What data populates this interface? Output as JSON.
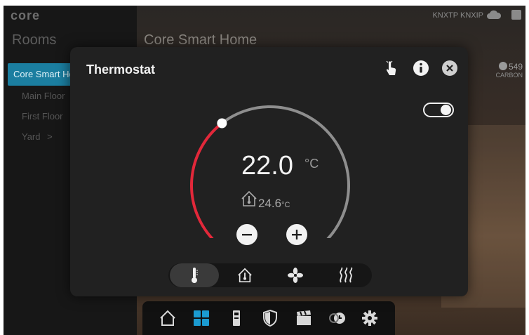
{
  "app": {
    "logo": "core"
  },
  "sidebar": {
    "title": "Rooms",
    "active_room": "Core Smart Home",
    "rooms": [
      {
        "label": "Main Floor"
      },
      {
        "label": "First Floor"
      },
      {
        "label": "Yard"
      }
    ]
  },
  "main": {
    "title": "Core Smart Home",
    "status_text": "KNXTP  KNXIP",
    "carbon_value": "549",
    "carbon_label": "CARBON"
  },
  "thermostat": {
    "title": "Thermostat",
    "power_on": true,
    "setpoint": "22.0",
    "setpoint_unit": "°C",
    "room_temperature": "24.6",
    "room_temperature_unit": "°C",
    "dial_fraction": 0.36,
    "colors": {
      "heat_arc": "#e2283a",
      "track_arc": "#8e8e8e",
      "panel": "#212121"
    },
    "modes": [
      {
        "icon": "thermometer-icon",
        "active": true
      },
      {
        "icon": "house-thermometer-icon",
        "active": false
      },
      {
        "icon": "fan-icon",
        "active": false
      },
      {
        "icon": "heat-waves-icon",
        "active": false
      }
    ]
  },
  "bottom_nav": [
    {
      "icon": "home-icon"
    },
    {
      "icon": "grid-icon",
      "active": true
    },
    {
      "icon": "intercom-icon"
    },
    {
      "icon": "shield-icon"
    },
    {
      "icon": "scene-clapper-icon"
    },
    {
      "icon": "schedule-clock-icon"
    },
    {
      "icon": "gear-icon"
    }
  ]
}
